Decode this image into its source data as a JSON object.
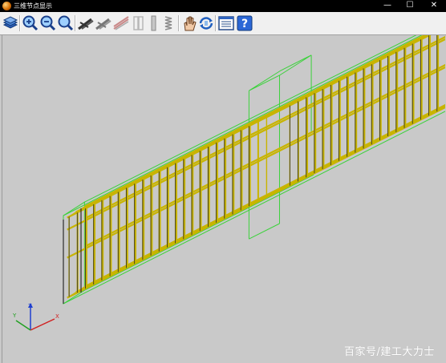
{
  "window": {
    "title": "三维节点显示",
    "controls": {
      "minimize": "—",
      "maximize": "☐",
      "close": "✕"
    }
  },
  "toolbar": {
    "buttons": [
      {
        "name": "layers-icon"
      },
      {
        "name": "zoom-in-icon"
      },
      {
        "name": "zoom-out-icon"
      },
      {
        "name": "zoom-fit-icon"
      },
      {
        "name": "rebar-view-icon"
      },
      {
        "name": "rebar-view-gray-icon"
      },
      {
        "name": "rebar-diagonal-icon"
      },
      {
        "name": "stirrup-icon"
      },
      {
        "name": "column-icon"
      },
      {
        "name": "spring-icon"
      },
      {
        "name": "pan-hand-icon"
      },
      {
        "name": "rotate-icon"
      },
      {
        "name": "properties-icon"
      },
      {
        "name": "help-icon"
      }
    ]
  },
  "axes": {
    "z": "Z",
    "y": "Y",
    "x": "X"
  },
  "colors": {
    "rebar": "#c8b400",
    "rebar_dark": "#2b2b2b",
    "outline": "#3bd23b",
    "background": "#c9c9c9"
  },
  "watermark": "百家号/建工大力士"
}
